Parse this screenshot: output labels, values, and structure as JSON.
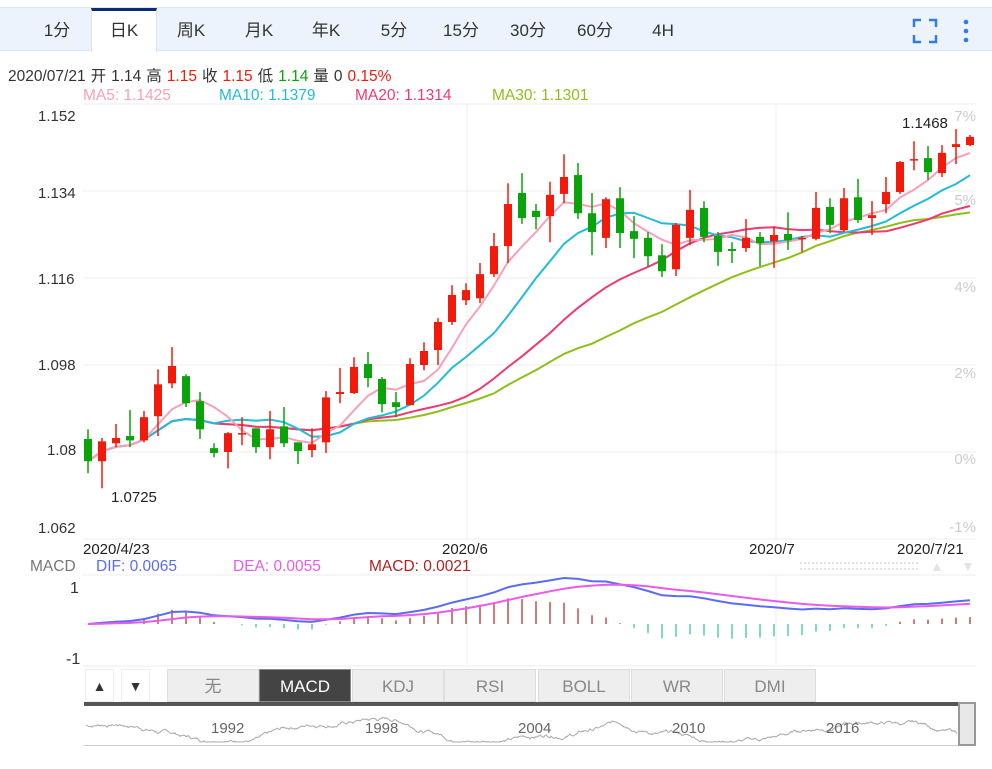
{
  "tabs": [
    {
      "label": "1分"
    },
    {
      "label": "日K",
      "active": true
    },
    {
      "label": "周K"
    },
    {
      "label": "月K"
    },
    {
      "label": "年K"
    },
    {
      "label": "5分"
    },
    {
      "label": "15分"
    },
    {
      "label": "30分"
    },
    {
      "label": "60分"
    },
    {
      "label": "4H"
    }
  ],
  "icons": {
    "fullscreen": "fullscreen-icon",
    "more": "more-vertical-icon"
  },
  "info": {
    "date": "2020/07/21",
    "open_label": "开",
    "open": "1.14",
    "high_label": "高",
    "high": "1.15",
    "close_label": "收",
    "close": "1.15",
    "low_label": "低",
    "low": "1.14",
    "vol_label": "量",
    "vol": "0",
    "change": "0.15%"
  },
  "ma": {
    "ma5": "MA5: 1.1425",
    "ma10": "MA10: 1.1379",
    "ma20": "MA20: 1.1314",
    "ma30": "MA30: 1.1301"
  },
  "colors": {
    "up": "#f21a0a",
    "down": "#0aa30a",
    "ma5": "#f7a1b9",
    "ma10": "#22bcd8",
    "ma20": "#ee3a72",
    "ma30": "#8fbf1a",
    "dif": "#5a6cf0",
    "dea": "#e85ce8",
    "macd": "#b22222",
    "hist_down": "#2cbf96"
  },
  "chart_data": {
    "type": "candlestick",
    "y_ticks": [
      "1.152",
      "1.134",
      "1.116",
      "1.098",
      "1.08",
      "1.062"
    ],
    "ylim": [
      1.062,
      1.152
    ],
    "pct_ticks": [
      "7%",
      "5%",
      "4%",
      "2%",
      "0%",
      "-1%"
    ],
    "x_labels": [
      "2020/4/23",
      "2020/6",
      "2020/7",
      "2020/7/21"
    ],
    "annotations": {
      "max": "1.1468",
      "min": "1.0725"
    },
    "ohlc": [
      [
        1.0827,
        1.0847,
        1.0756,
        1.0781
      ],
      [
        1.0781,
        1.0829,
        1.0725,
        1.0822
      ],
      [
        1.0818,
        1.0858,
        1.081,
        1.0829
      ],
      [
        1.0833,
        1.0887,
        1.081,
        1.0824
      ],
      [
        1.0824,
        1.0885,
        1.082,
        1.0872
      ],
      [
        1.0874,
        1.0971,
        1.0833,
        1.094
      ],
      [
        1.0942,
        1.1017,
        1.0932,
        1.0978
      ],
      [
        1.0957,
        1.0961,
        1.0893,
        1.0901
      ],
      [
        1.0905,
        1.0924,
        1.0827,
        1.0847
      ],
      [
        1.0808,
        1.0818,
        1.0789,
        1.0798
      ],
      [
        1.08,
        1.0841,
        1.0766,
        1.0839
      ],
      [
        1.0837,
        1.0872,
        1.0814,
        1.0839
      ],
      [
        1.0849,
        1.0849,
        1.0798,
        1.081
      ],
      [
        1.081,
        1.0885,
        1.0785,
        1.0847
      ],
      [
        1.0853,
        1.0893,
        1.081,
        1.0818
      ],
      [
        1.082,
        1.082,
        1.0775,
        1.0802
      ],
      [
        1.0804,
        1.0849,
        1.0789,
        1.0816
      ],
      [
        1.082,
        1.0926,
        1.0798,
        1.0913
      ],
      [
        1.092,
        1.0974,
        1.0901,
        1.0924
      ],
      [
        1.0922,
        1.0996,
        1.092,
        1.0976
      ],
      [
        1.0982,
        1.1007,
        1.0934,
        1.0953
      ],
      [
        1.0951,
        1.0955,
        1.0882,
        1.0899
      ],
      [
        1.0903,
        1.0924,
        1.0872,
        1.0893
      ],
      [
        1.0897,
        1.0994,
        1.0897,
        1.0982
      ],
      [
        1.098,
        1.1027,
        1.0969,
        1.1009
      ],
      [
        1.1011,
        1.1077,
        1.098,
        1.1069
      ],
      [
        1.1069,
        1.1145,
        1.1063,
        1.1125
      ],
      [
        1.1114,
        1.1149,
        1.1104,
        1.1135
      ],
      [
        1.1118,
        1.1191,
        1.1108,
        1.1168
      ],
      [
        1.1168,
        1.1253,
        1.1162,
        1.1226
      ],
      [
        1.1226,
        1.1356,
        1.1191,
        1.1313
      ],
      [
        1.1336,
        1.1377,
        1.1272,
        1.1284
      ],
      [
        1.1299,
        1.1313,
        1.1261,
        1.1286
      ],
      [
        1.1288,
        1.1359,
        1.1234,
        1.1332
      ],
      [
        1.1334,
        1.1416,
        1.1315,
        1.1369
      ],
      [
        1.1373,
        1.1398,
        1.1282,
        1.1294
      ],
      [
        1.1294,
        1.1336,
        1.1207,
        1.1255
      ],
      [
        1.1243,
        1.1327,
        1.1222,
        1.1323
      ],
      [
        1.1325,
        1.1348,
        1.1222,
        1.1253
      ],
      [
        1.1257,
        1.1288,
        1.1201,
        1.1241
      ],
      [
        1.1243,
        1.1255,
        1.1183,
        1.1205
      ],
      [
        1.1207,
        1.123,
        1.1162,
        1.1174
      ],
      [
        1.1178,
        1.1274,
        1.1164,
        1.127
      ],
      [
        1.1243,
        1.1342,
        1.1228,
        1.1301
      ],
      [
        1.1305,
        1.1319,
        1.1234,
        1.1245
      ],
      [
        1.1247,
        1.1255,
        1.1185,
        1.1214
      ],
      [
        1.122,
        1.1234,
        1.1191,
        1.1216
      ],
      [
        1.1222,
        1.1282,
        1.1214,
        1.1243
      ],
      [
        1.1245,
        1.1255,
        1.1185,
        1.1232
      ],
      [
        1.1236,
        1.1267,
        1.1181,
        1.1249
      ],
      [
        1.1251,
        1.1296,
        1.1218,
        1.1238
      ],
      [
        1.1241,
        1.1247,
        1.1214,
        1.1243
      ],
      [
        1.1241,
        1.1338,
        1.1238,
        1.1305
      ],
      [
        1.1307,
        1.1325,
        1.1253,
        1.127
      ],
      [
        1.1259,
        1.1346,
        1.1255,
        1.1325
      ],
      [
        1.1327,
        1.1365,
        1.1274,
        1.128
      ],
      [
        1.1284,
        1.1319,
        1.1249,
        1.129
      ],
      [
        1.1313,
        1.1369,
        1.1294,
        1.1338
      ],
      [
        1.1338,
        1.1402,
        1.1334,
        1.14
      ],
      [
        1.1404,
        1.1443,
        1.1383,
        1.1406
      ],
      [
        1.1408,
        1.1433,
        1.1363,
        1.1379
      ],
      [
        1.1377,
        1.1435,
        1.1369,
        1.1419
      ],
      [
        1.1431,
        1.1468,
        1.1396,
        1.1437
      ],
      [
        1.1435,
        1.1456,
        1.1433,
        1.1452
      ]
    ]
  },
  "macd": {
    "label": "MACD",
    "dif": "DIF: 0.0065",
    "dea": "DEA: 0.0055",
    "macd": "MACD: 0.0021",
    "y_top": "1",
    "y_bottom": "-1"
  },
  "indicator_tabs": [
    {
      "label": "无"
    },
    {
      "label": "MACD",
      "active": true
    },
    {
      "label": "KDJ"
    },
    {
      "label": "RSI"
    },
    {
      "label": "BOLL"
    },
    {
      "label": "WR"
    },
    {
      "label": "DMI"
    }
  ],
  "arrows": {
    "up": "▲",
    "down": "▼"
  },
  "navigator": {
    "years": [
      "1992",
      "1998",
      "2004",
      "2010",
      "2016"
    ]
  }
}
